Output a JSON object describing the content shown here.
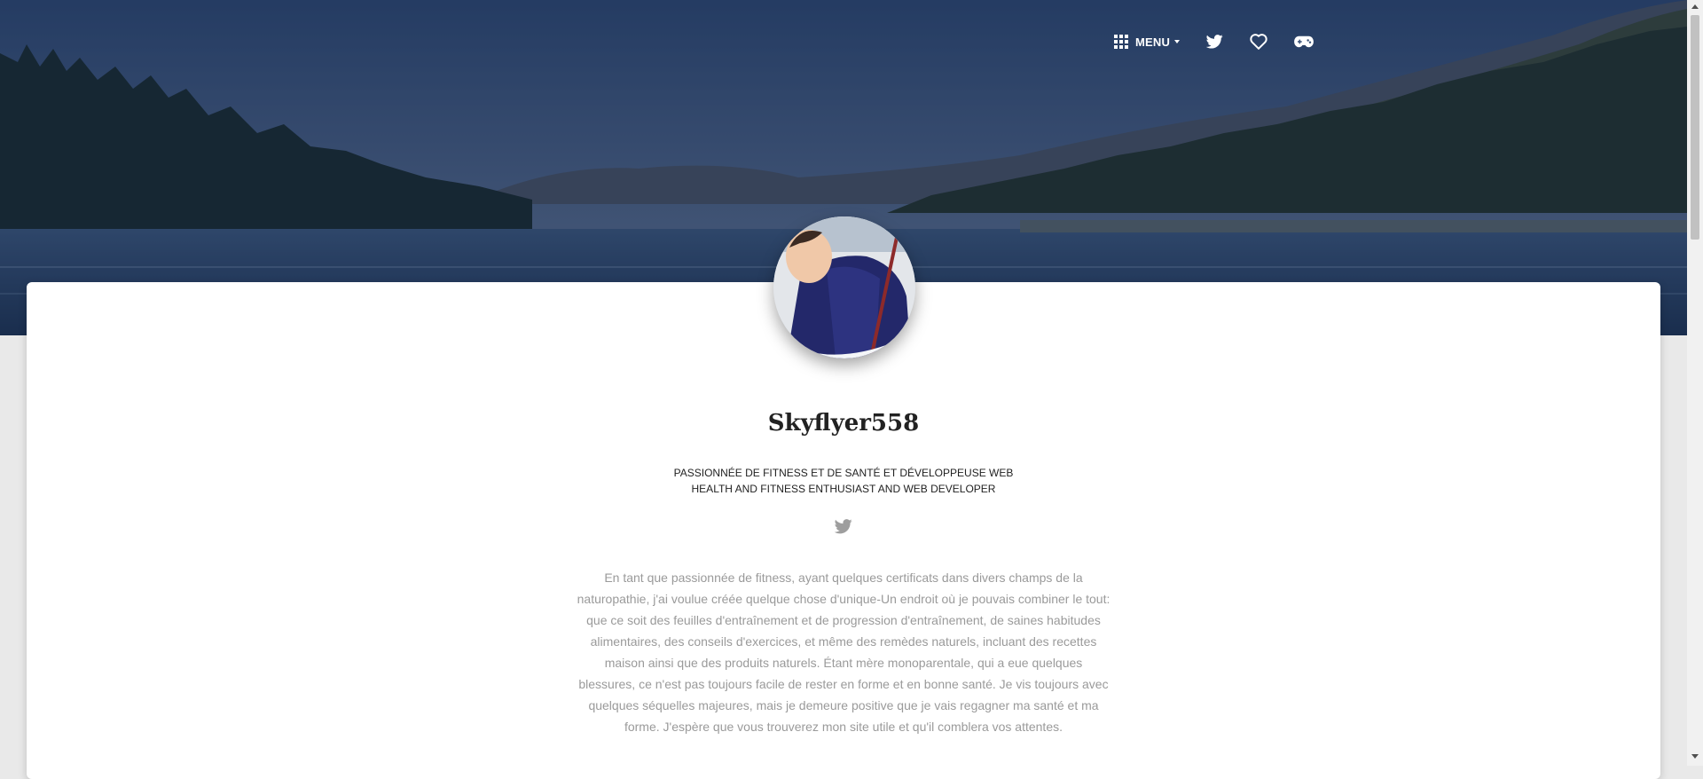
{
  "header": {
    "menu_label": "MENU",
    "menu_icon": "grid-icon",
    "nav_icons": [
      "twitter-icon",
      "heart-icon",
      "gamepad-icon"
    ]
  },
  "hero": {
    "background": "forest-lake-landscape"
  },
  "profile": {
    "avatar": "profile-photo",
    "name": "Skyflyer558",
    "tagline_fr": "PASSIONNÉE DE FITNESS ET DE SANTÉ ET DÉVELOPPEUSE WEB",
    "tagline_en": "HEALTH AND FITNESS ENTHUSIAST AND WEB DEVELOPER",
    "social_icon": "twitter-icon",
    "bio": "En tant que passionnée de fitness, ayant quelques certificats dans divers champs de la naturopathie, j'ai voulue créée quelque chose d'unique-Un endroit où je pouvais combiner le tout: que ce soit des feuilles d'entraînement et de progression d'entraînement, de saines habitudes alimentaires, des conseils d'exercices, et même des remèdes naturels, incluant des recettes maison ainsi que des produits naturels. Étant mère monoparentale, qui a eue quelques blessures, ce n'est pas toujours facile de rester en forme et en bonne santé. Je vis toujours avec quelques séquelles majeures, mais je demeure positive que je vais regagner ma santé et ma forme. J'espère que vous trouverez mon site utile et qu'il comblera vos attentes."
  },
  "colors": {
    "nav_text": "#ffffff",
    "name_text": "#222222",
    "bio_text": "#9a9a9a",
    "page_bg": "#e9e9e9",
    "card_bg": "#ffffff"
  }
}
